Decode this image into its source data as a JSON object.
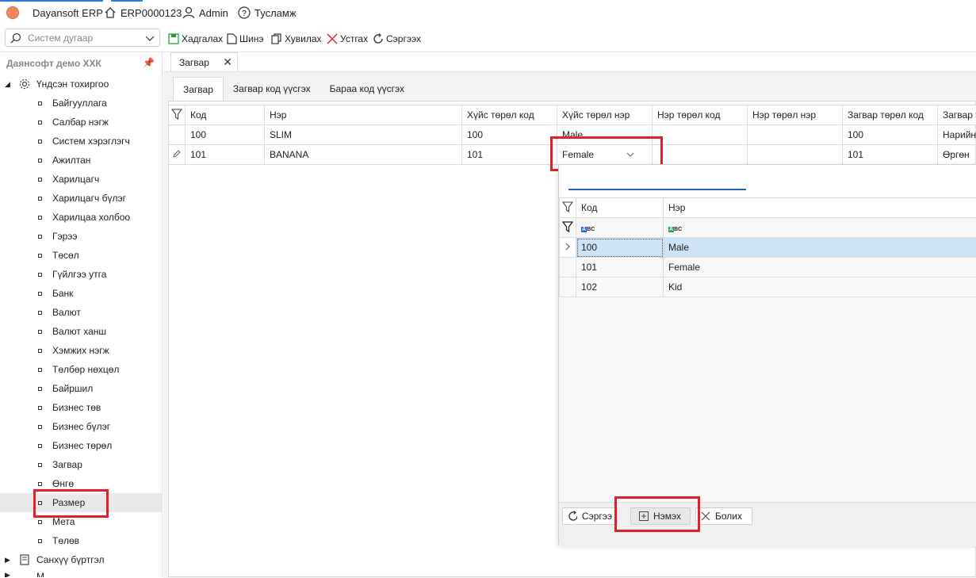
{
  "app": {
    "title": "Dayansoft ERP",
    "code": "ERP0000123",
    "user": "Admin",
    "help": "Тусламж"
  },
  "search": {
    "placeholder": "Систем дугаар"
  },
  "toolbar": {
    "save": "Хадгалах",
    "new": "Шинэ",
    "copy": "Хувилах",
    "delete": "Устгах",
    "refresh": "Сэргээх"
  },
  "sidebar": {
    "company": "Даянсофт демо ХХК",
    "root": "Үндсэн тохиргоо",
    "items": [
      "Байгууллага",
      "Салбар нэгж",
      "Систем хэрэглэгч",
      "Ажилтан",
      "Харилцагч",
      "Харилцагч бүлэг",
      "Харилцаа холбоо",
      "Гэрээ",
      "Төсөл",
      "Гүйлгээ утга",
      "Банк",
      "Валют",
      "Валют ханш",
      "Хэмжих нэгж",
      "Төлбөр нөхцөл",
      "Байршил",
      "Бизнес төв",
      "Бизнес бүлэг",
      "Бизнес төрөл",
      "Загвар",
      "Өнгө",
      "Размер",
      "Мета",
      "Төлөв"
    ],
    "selected": "Размер",
    "next_root": "Санхүү бүртгэл",
    "next_root2": "М"
  },
  "doc_tab": {
    "label": "Загвар"
  },
  "sub_tabs": [
    "Загвар",
    "Загвар код үүсгэх",
    "Бараа код үүсгэх"
  ],
  "main_grid": {
    "columns": [
      "Код",
      "Нэр",
      "Хүйс төрөл код",
      "Хүйс төрөл нэр",
      "Нэр төрөл код",
      "Нэр төрөл нэр",
      "Загвар төрөл код",
      "Загвар т"
    ],
    "rows": [
      [
        "100",
        "SLIM",
        "100",
        "Male",
        "",
        "",
        "100",
        "Нарийн"
      ],
      [
        "101",
        "BANANA",
        "101",
        "Female",
        "",
        "",
        "101",
        "Өргөн"
      ]
    ]
  },
  "popup": {
    "columns": [
      "Код",
      "Нэр"
    ],
    "rows": [
      [
        "100",
        "Male"
      ],
      [
        "101",
        "Female"
      ],
      [
        "102",
        "Kid"
      ]
    ],
    "filter_abc": "ABC",
    "buttons": {
      "refresh": "Сэргээ",
      "add": "Нэмэх",
      "cancel": "Болих"
    }
  },
  "colors": {
    "accent": "#2b7bd6",
    "highlight": "#e0202a",
    "row_selected": "#cfe3f7"
  }
}
